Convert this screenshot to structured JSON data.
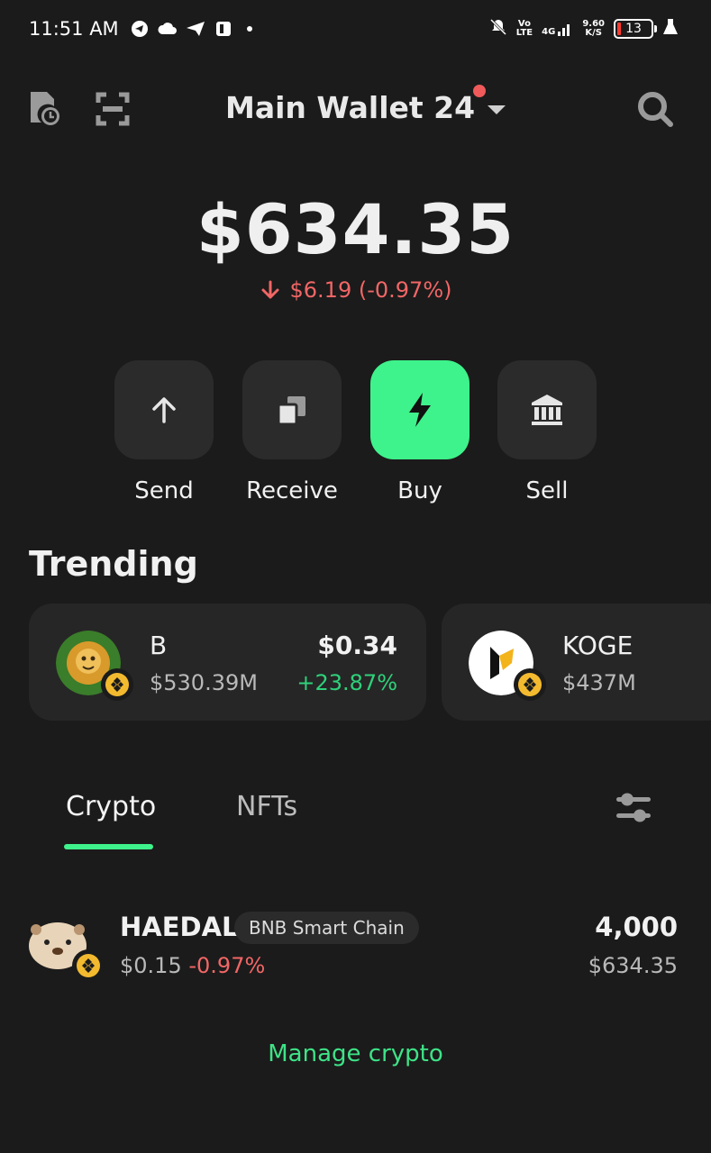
{
  "status_bar": {
    "time": "11:51 AM",
    "notification_icons": [
      "telegram-icon",
      "cloud-icon",
      "send-icon",
      "app-icon"
    ],
    "net_top": "Vo",
    "net_bottom": "LTE",
    "signal_label": "4G",
    "speed_top": "9.60",
    "speed_bottom": "K/S",
    "battery": "13"
  },
  "header": {
    "wallet_name": "Main Wallet 24"
  },
  "balance": {
    "total": "$634.35",
    "change": "$6.19 (-0.97%)"
  },
  "actions": [
    {
      "label": "Send"
    },
    {
      "label": "Receive"
    },
    {
      "label": "Buy"
    },
    {
      "label": "Sell"
    }
  ],
  "trending": {
    "title": "Trending",
    "items": [
      {
        "name": "B",
        "market_cap": "$530.39M",
        "price": "$0.34",
        "change": "+23.87%"
      },
      {
        "name": "KOGE",
        "market_cap": "$437M"
      }
    ]
  },
  "tabs": [
    {
      "label": "Crypto"
    },
    {
      "label": "NFTs"
    }
  ],
  "assets": [
    {
      "name": "HAEDAL",
      "chain": "BNB Smart Chain",
      "price": "$0.15",
      "change": "-0.97%",
      "amount": "4,000",
      "value": "$634.35"
    }
  ],
  "manage_label": "Manage crypto",
  "colors": {
    "background": "#1b1b1b",
    "accent": "#3ef38b",
    "negative": "#f26666",
    "positive": "#2fd17a"
  }
}
